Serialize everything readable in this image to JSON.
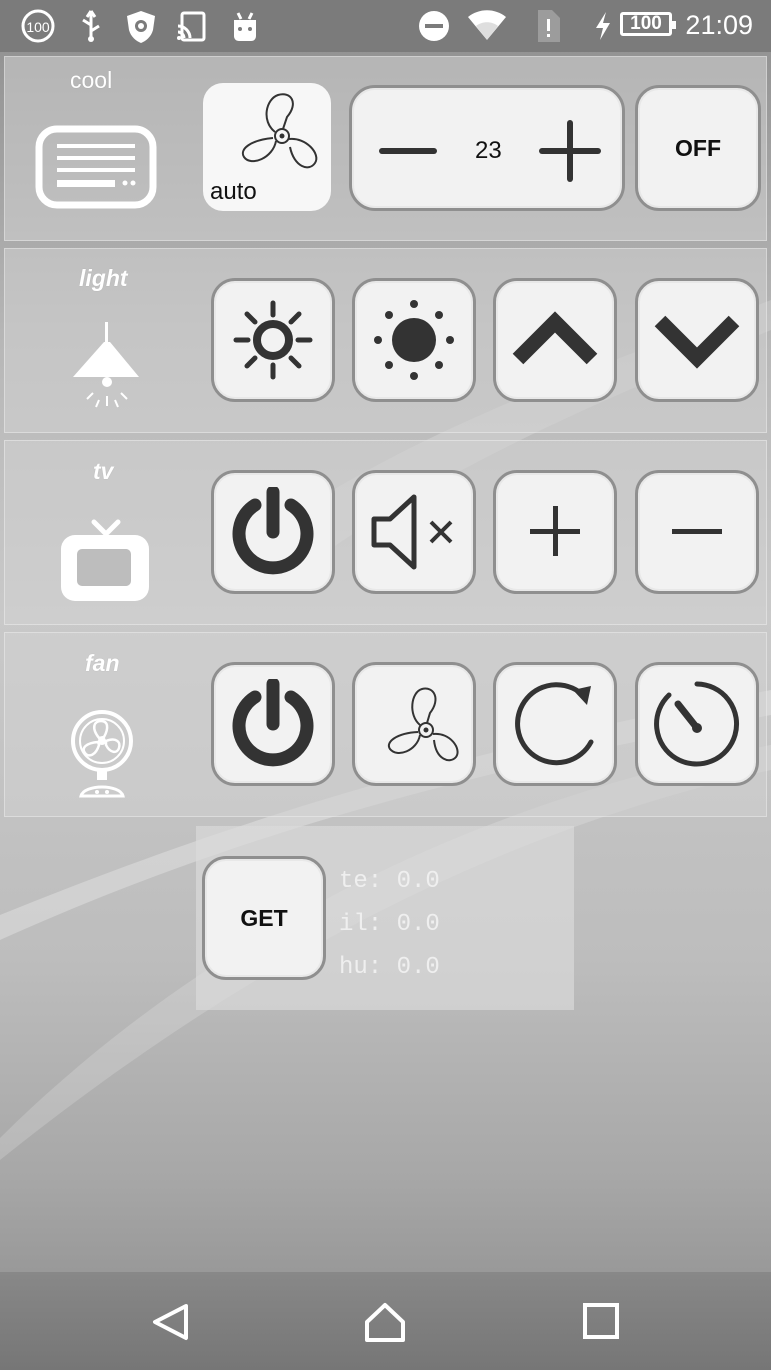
{
  "status_bar": {
    "left_icon_label": "100",
    "battery_level": "100",
    "time": "21:09"
  },
  "cool": {
    "label": "cool",
    "fan_mode": "auto",
    "temperature": "23",
    "power_label": "OFF"
  },
  "light": {
    "label": "light"
  },
  "tv": {
    "label": "tv"
  },
  "fan": {
    "label": "fan"
  },
  "sensor": {
    "get_label": "GET",
    "readings": [
      {
        "text": "te: 0.0"
      },
      {
        "text": "il: 0.0"
      },
      {
        "text": "hu: 0.0"
      }
    ]
  }
}
